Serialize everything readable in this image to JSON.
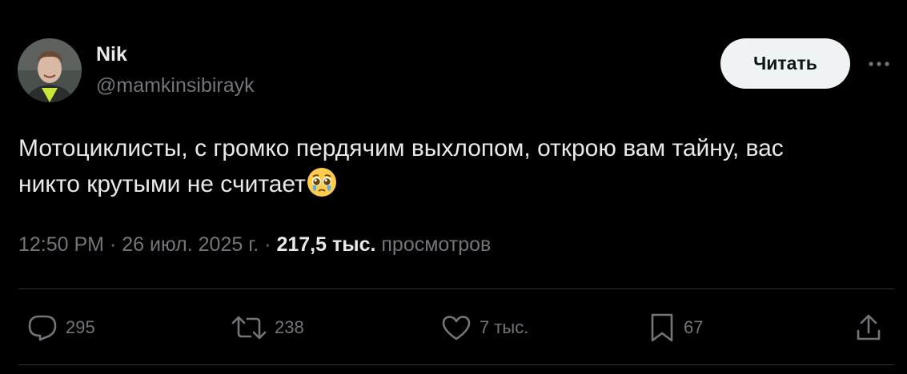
{
  "author": {
    "name": "Nik",
    "handle": "@mamkinsibirayk",
    "avatar_icon": "profile-photo"
  },
  "header": {
    "follow_label": "Читать",
    "more_icon": "more-dots-icon"
  },
  "tweet": {
    "text_line1": "Мотоциклисты, с громко пердячим выхлопом, открою вам тайну, вас",
    "text_line2": "никто крутыми не считает",
    "emoji": "pleading-face-emoji"
  },
  "meta": {
    "time": "12:50 PM",
    "separator": "·",
    "date": "26 июл. 2025 г.",
    "views_count": "217,5 тыс.",
    "views_label": "просмотров"
  },
  "actions": {
    "replies": "295",
    "reposts": "238",
    "likes": "7 тыс.",
    "bookmarks": "67"
  },
  "colors": {
    "background": "#000000",
    "text": "#e7e9ea",
    "muted": "#71767b",
    "divider": "#2f3336",
    "button_bg": "#eff3f4"
  }
}
